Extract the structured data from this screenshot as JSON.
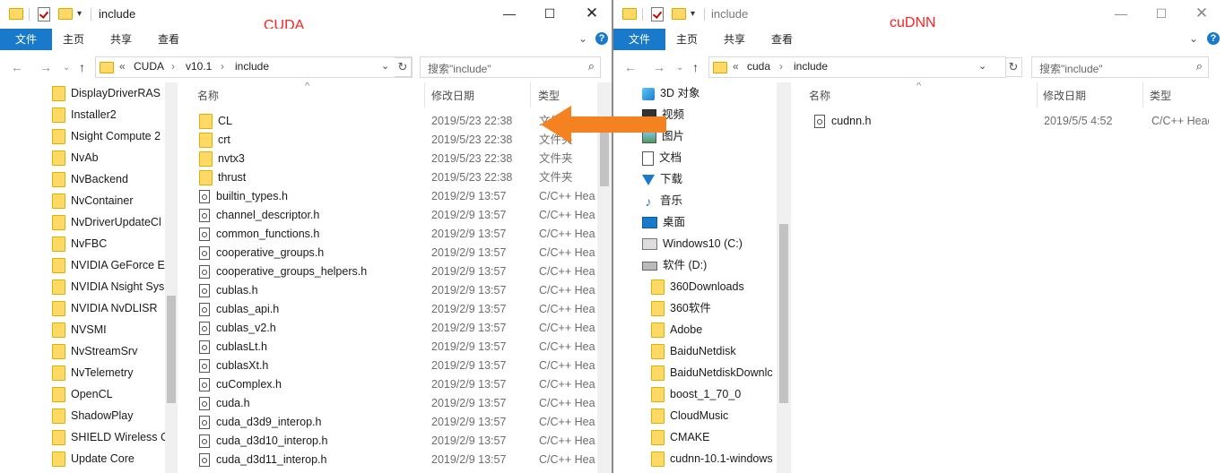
{
  "left": {
    "title": "include",
    "annotation": "CUDA",
    "ribbon": {
      "file": "文件",
      "home": "主页",
      "share": "共享",
      "view": "查看"
    },
    "breadcrumb": {
      "lead": "«",
      "items": [
        "CUDA",
        "v10.1",
        "include"
      ]
    },
    "search_placeholder": "搜索\"include\"",
    "columns": {
      "name": "名称",
      "date": "修改日期",
      "type": "类型"
    },
    "nav_items": [
      "DisplayDriverRAS",
      "Installer2",
      "Nsight Compute 2",
      "NvAb",
      "NvBackend",
      "NvContainer",
      "NvDriverUpdateCl",
      "NvFBC",
      "NVIDIA GeForce E",
      "NVIDIA Nsight Sys",
      "NVIDIA NvDLISR",
      "NVSMI",
      "NvStreamSrv",
      "NvTelemetry",
      "OpenCL",
      "ShadowPlay",
      "SHIELD Wireless C",
      "Update Core"
    ],
    "files": [
      {
        "name": "CL",
        "date": "2019/5/23 22:38",
        "type": "文件夹",
        "folder": true
      },
      {
        "name": "crt",
        "date": "2019/5/23 22:38",
        "type": "文件夹",
        "folder": true
      },
      {
        "name": "nvtx3",
        "date": "2019/5/23 22:38",
        "type": "文件夹",
        "folder": true
      },
      {
        "name": "thrust",
        "date": "2019/5/23 22:38",
        "type": "文件夹",
        "folder": true
      },
      {
        "name": "builtin_types.h",
        "date": "2019/2/9 13:57",
        "type": "C/C++ Hea",
        "folder": false
      },
      {
        "name": "channel_descriptor.h",
        "date": "2019/2/9 13:57",
        "type": "C/C++ Hea",
        "folder": false
      },
      {
        "name": "common_functions.h",
        "date": "2019/2/9 13:57",
        "type": "C/C++ Hea",
        "folder": false
      },
      {
        "name": "cooperative_groups.h",
        "date": "2019/2/9 13:57",
        "type": "C/C++ Hea",
        "folder": false
      },
      {
        "name": "cooperative_groups_helpers.h",
        "date": "2019/2/9 13:57",
        "type": "C/C++ Hea",
        "folder": false
      },
      {
        "name": "cublas.h",
        "date": "2019/2/9 13:57",
        "type": "C/C++ Hea",
        "folder": false
      },
      {
        "name": "cublas_api.h",
        "date": "2019/2/9 13:57",
        "type": "C/C++ Hea",
        "folder": false
      },
      {
        "name": "cublas_v2.h",
        "date": "2019/2/9 13:57",
        "type": "C/C++ Hea",
        "folder": false
      },
      {
        "name": "cublasLt.h",
        "date": "2019/2/9 13:57",
        "type": "C/C++ Hea",
        "folder": false
      },
      {
        "name": "cublasXt.h",
        "date": "2019/2/9 13:57",
        "type": "C/C++ Hea",
        "folder": false
      },
      {
        "name": "cuComplex.h",
        "date": "2019/2/9 13:57",
        "type": "C/C++ Hea",
        "folder": false
      },
      {
        "name": "cuda.h",
        "date": "2019/2/9 13:57",
        "type": "C/C++ Hea",
        "folder": false
      },
      {
        "name": "cuda_d3d9_interop.h",
        "date": "2019/2/9 13:57",
        "type": "C/C++ Hea",
        "folder": false
      },
      {
        "name": "cuda_d3d10_interop.h",
        "date": "2019/2/9 13:57",
        "type": "C/C++ Hea",
        "folder": false
      },
      {
        "name": "cuda_d3d11_interop.h",
        "date": "2019/2/9 13:57",
        "type": "C/C++ Hea",
        "folder": false
      }
    ]
  },
  "right": {
    "title": "include",
    "annotation": "cuDNN",
    "ribbon": {
      "file": "文件",
      "home": "主页",
      "share": "共享",
      "view": "查看"
    },
    "breadcrumb": {
      "lead": "«",
      "items": [
        "cuda",
        "include"
      ]
    },
    "search_placeholder": "搜索\"include\"",
    "columns": {
      "name": "名称",
      "date": "修改日期",
      "type": "类型"
    },
    "nav_special": [
      {
        "label": "3D 对象",
        "icon": "3d-objects-icon"
      },
      {
        "label": "视频",
        "icon": "video-icon"
      },
      {
        "label": "图片",
        "icon": "pictures-icon"
      },
      {
        "label": "文档",
        "icon": "documents-icon"
      },
      {
        "label": "下载",
        "icon": "downloads-icon"
      },
      {
        "label": "音乐",
        "icon": "music-icon"
      },
      {
        "label": "桌面",
        "icon": "desktop-icon"
      },
      {
        "label": "Windows10 (C:)",
        "icon": "windows-drive-icon"
      },
      {
        "label": "软件 (D:)",
        "icon": "drive-icon"
      }
    ],
    "nav_folders": [
      "360Downloads",
      "360软件",
      "Adobe",
      "BaiduNetdisk",
      "BaiduNetdiskDownlc",
      "boost_1_70_0",
      "CloudMusic",
      "CMAKE",
      "cudnn-10.1-windows"
    ],
    "files": [
      {
        "name": "cudnn.h",
        "date": "2019/5/5 4:52",
        "type": "C/C++ Heade"
      }
    ]
  },
  "colors": {
    "accent": "#1979ca",
    "annotation": "#ff2020",
    "arrow": "#f58220"
  }
}
